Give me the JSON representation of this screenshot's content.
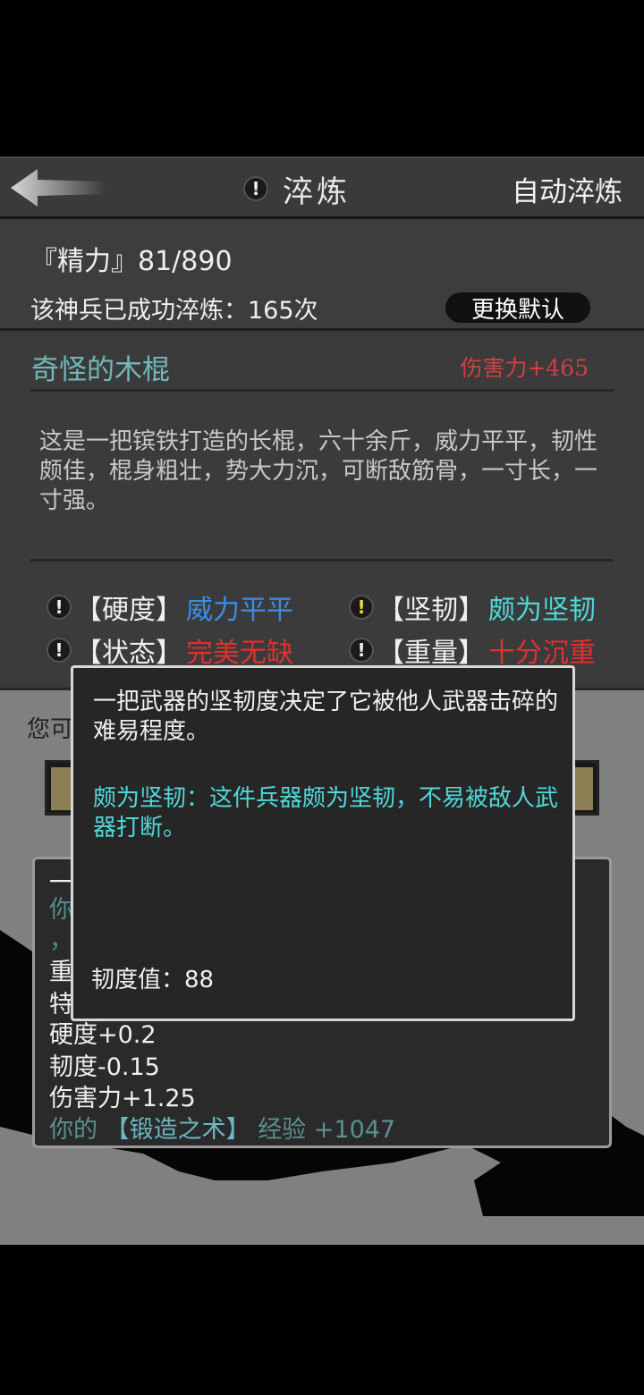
{
  "header": {
    "title": "淬炼",
    "auto_refine_label": "自动淬炼",
    "back_icon": "back-arrow-icon",
    "info_icon": "exclamation-icon"
  },
  "info": {
    "energy": "『精力』81/890",
    "refine_count": "该神兵已成功淬炼：165次",
    "change_default_label": "更换默认"
  },
  "weapon": {
    "name": "奇怪的木棍",
    "damage": "伤害力+465",
    "description": "这是一把镔铁打造的长棍，六十余斤，威力平平，韧性颇佳，棍身粗壮，势大力沉，可断敌筋骨，一寸长，一寸强。",
    "attributes": [
      {
        "label": "【硬度】",
        "value": "威力平平",
        "color": "#3a8ee6"
      },
      {
        "label": "【坚韧】",
        "value": "颇为坚韧",
        "color": "#4fd8d8"
      },
      {
        "label": "【状态】",
        "value": "完美无缺",
        "color": "#e03030"
      },
      {
        "label": "【重量】",
        "value": "十分沉重",
        "color": "#e03030"
      }
    ]
  },
  "lower": {
    "you_can_partial": "您可",
    "log_lines": [
      "一",
      "你",
      "，",
      "重",
      "特",
      "硬度+0.2",
      "韧度-0.15",
      "伤害力+1.25"
    ],
    "skill_prefix": "你的",
    "skill_name": "【锻造之术】",
    "skill_exp": "经验 +1047"
  },
  "tooltip": {
    "description": "一把武器的坚韧度决定了它被他人武器击碎的难易程度。",
    "level_text": "颇为坚韧：这件兵器颇为坚韧，不易被敌人武器打断。",
    "value_text": "韧度值：88"
  },
  "colors": {
    "accent_cyan": "#4fd8d8",
    "damage_red": "#d04040",
    "hardness_blue": "#3a8ee6",
    "warning_yellow": "#e8d84a"
  }
}
